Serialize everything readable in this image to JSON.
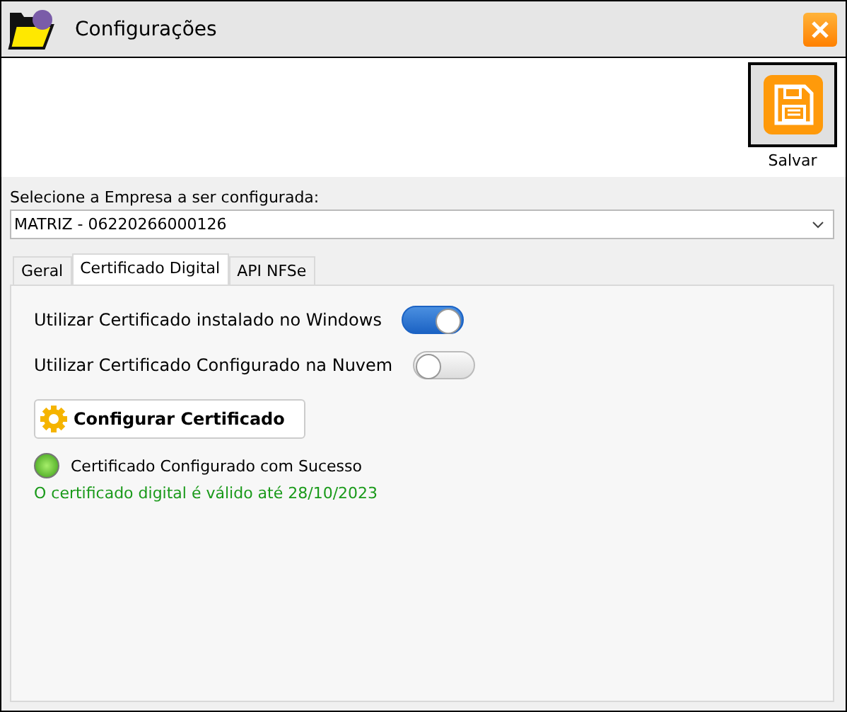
{
  "window": {
    "title": "Configurações"
  },
  "toolbar": {
    "save_label": "Salvar"
  },
  "company": {
    "label": "Selecione a Empresa a ser configurada:",
    "value": "MATRIZ - 06220266000126"
  },
  "tabs": [
    {
      "label": "Geral",
      "selected": false
    },
    {
      "label": "Certificado Digital",
      "selected": true
    },
    {
      "label": "API NFSe",
      "selected": false
    }
  ],
  "toggles": [
    {
      "label": "Utilizar Certificado instalado no Windows",
      "on": true
    },
    {
      "label": "Utilizar Certificado Configurado na Nuvem",
      "on": false
    }
  ],
  "configure_button": "Configurar Certificado",
  "status": {
    "on": true,
    "text": "Certificado Configurado com Sucesso"
  },
  "validity": "O certificado digital é válido até 28/10/2023"
}
